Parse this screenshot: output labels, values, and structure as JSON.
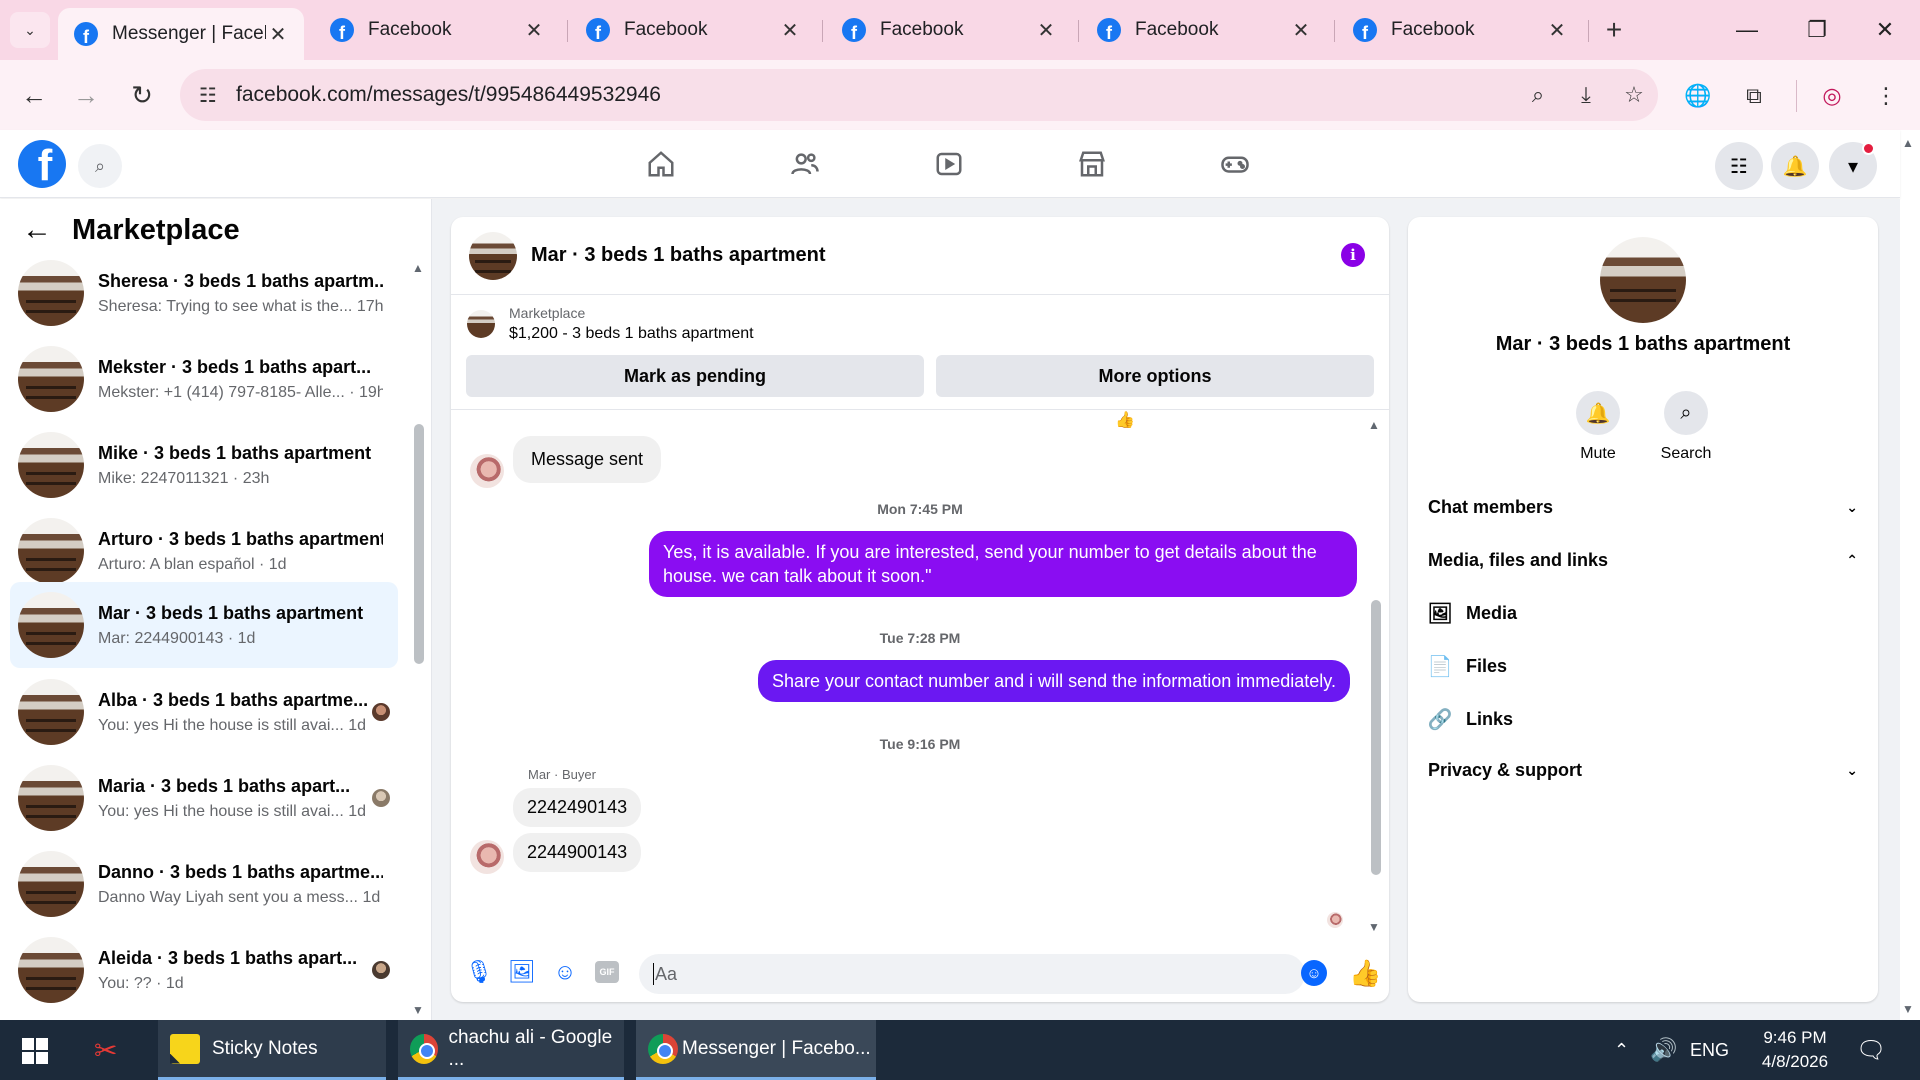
{
  "browser": {
    "tabs": [
      {
        "title": "Messenger | Facebook",
        "active": true
      },
      {
        "title": "Facebook",
        "active": false
      },
      {
        "title": "Facebook",
        "active": false
      },
      {
        "title": "Facebook",
        "active": false
      },
      {
        "title": "Facebook",
        "active": false
      },
      {
        "title": "Facebook",
        "active": false
      }
    ],
    "url": "facebook.com/messages/t/995486449532946"
  },
  "sidebar": {
    "title": "Marketplace",
    "conversations": [
      {
        "name": "Sheresa · 3 beds 1 baths apartm...",
        "preview": "Sheresa: Trying to see what is the...",
        "time": "17h"
      },
      {
        "name": "Mekster · 3 beds 1 baths apart...",
        "preview": "Mekster: +1 (414) 797-8185- Alle...",
        "time": "19h"
      },
      {
        "name": "Mike · 3 beds 1 baths apartment",
        "preview": "Mike: 2247011321",
        "time": "23h"
      },
      {
        "name": "Arturo · 3 beds 1 baths apartment",
        "preview": "Arturo: A blan español",
        "time": "1d"
      },
      {
        "name": "Mar · 3 beds 1 baths apartment",
        "preview": "Mar: 2244900143",
        "time": "1d",
        "active": true
      },
      {
        "name": "Alba · 3 beds 1 baths apartme...",
        "preview": "You: yes Hi the house is still avai...",
        "time": "1d"
      },
      {
        "name": "Maria · 3 beds 1 baths apart...",
        "preview": "You: yes Hi the house is still avai...",
        "time": "1d"
      },
      {
        "name": "Danno · 3 beds 1 baths apartme...",
        "preview": "Danno Way Liyah sent you a mess...",
        "time": "1d"
      },
      {
        "name": "Aleida · 3 beds 1 baths apart...",
        "preview": "You: ??",
        "time": "1d"
      }
    ]
  },
  "chat": {
    "title": "Mar · 3 beds 1 baths apartment",
    "marketplace_label": "Marketplace",
    "listing": "$1,200 - 3 beds 1 baths apartment",
    "mark_pending": "Mark as pending",
    "more_options": "More options",
    "msg_sent": "Message sent",
    "stamp1": "Mon 7:45 PM",
    "out1": "Yes, it is available. If you are interested, send your number to get details about the house. we can talk about it soon.\"",
    "stamp2": "Tue 7:28 PM",
    "out2": "Share your contact number and i will send the information immediately.",
    "stamp3": "Tue 9:16 PM",
    "sender": "Mar · Buyer",
    "in1": "2242490143",
    "in2": "2244900143",
    "composer_placeholder": "Aa"
  },
  "info_panel": {
    "title": "Mar · 3 beds 1 baths apartment",
    "mute": "Mute",
    "search": "Search",
    "chat_members": "Chat members",
    "media_files_links": "Media, files and links",
    "media": "Media",
    "files": "Files",
    "links": "Links",
    "privacy": "Privacy & support"
  },
  "taskbar": {
    "apps": [
      {
        "label": "Sticky Notes"
      },
      {
        "label": "chachu ali - Google ..."
      },
      {
        "label": "Messenger | Facebo..."
      }
    ],
    "lang": "ENG",
    "time": "9:46 PM",
    "date": "4/8/2026"
  },
  "colors": {
    "fb_blue": "#1877f2",
    "outgoing_bubble": "#8a0df2",
    "active_conversation": "#ebf5ff",
    "tabstrip": "#f9d8e6"
  }
}
